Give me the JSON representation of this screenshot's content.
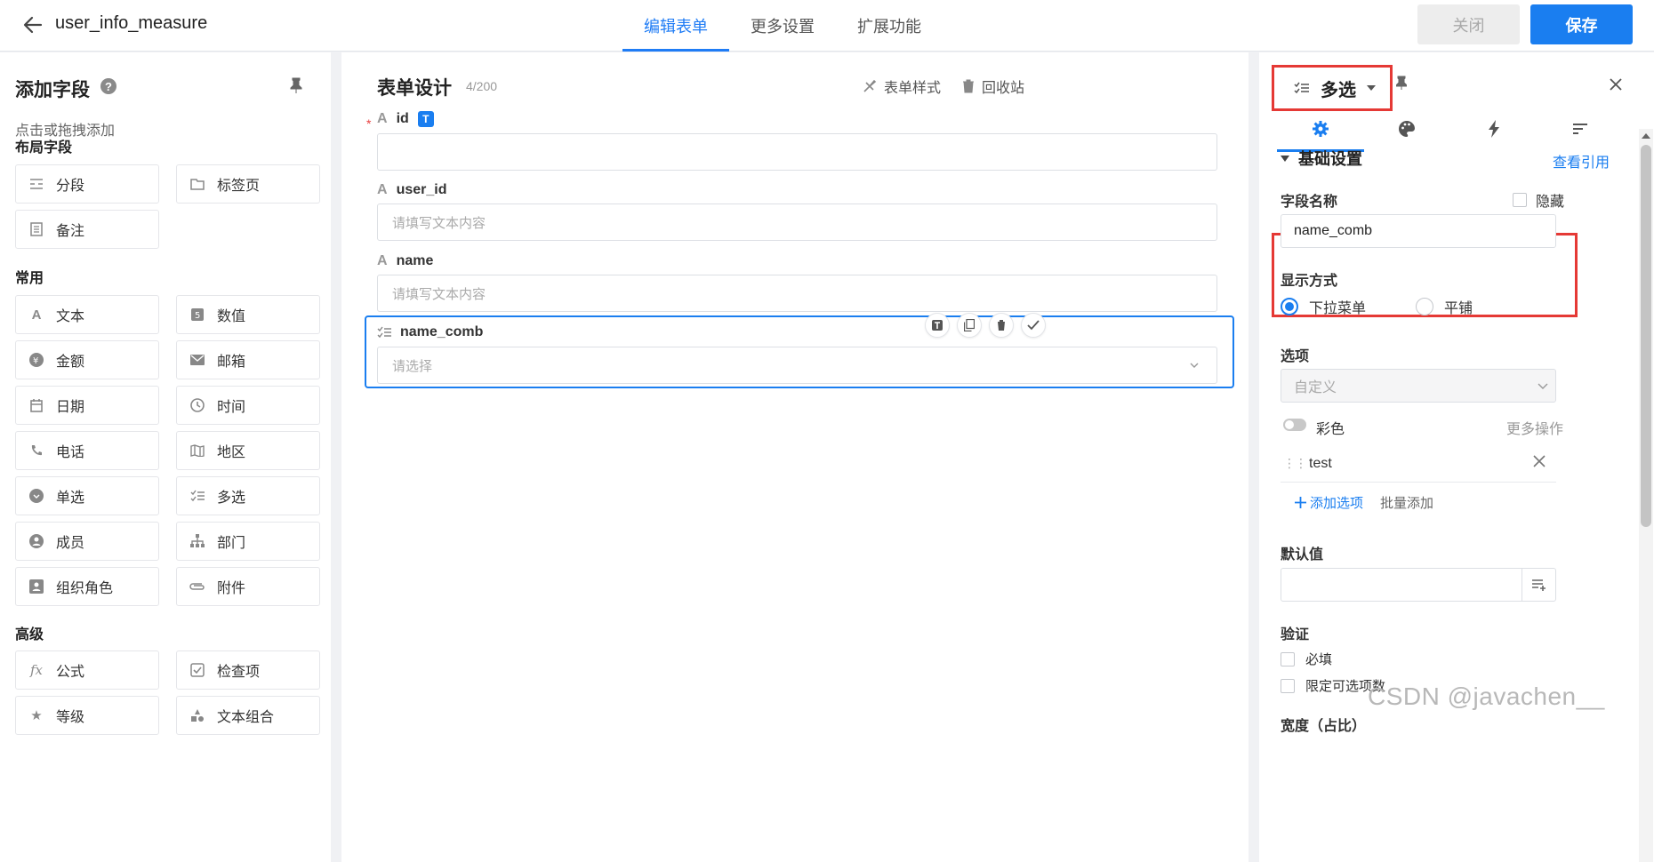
{
  "header": {
    "title": "user_info_measure",
    "tabs": [
      "编辑表单",
      "更多设置",
      "扩展功能"
    ],
    "close_label": "关闭",
    "save_label": "保存"
  },
  "left": {
    "title": "添加字段",
    "help": "?",
    "subtitle": "点击或拖拽添加",
    "groups": [
      {
        "title": "布局字段",
        "items": [
          {
            "label": "分段",
            "icon": "section-icon"
          },
          {
            "label": "标签页",
            "icon": "tab-page-icon"
          },
          {
            "label": "备注",
            "icon": "note-icon"
          }
        ]
      },
      {
        "title": "常用",
        "items": [
          {
            "label": "文本",
            "icon": "text-icon"
          },
          {
            "label": "数值",
            "icon": "number-icon"
          },
          {
            "label": "金额",
            "icon": "money-icon"
          },
          {
            "label": "邮箱",
            "icon": "email-icon"
          },
          {
            "label": "日期",
            "icon": "date-icon"
          },
          {
            "label": "时间",
            "icon": "time-icon"
          },
          {
            "label": "电话",
            "icon": "phone-icon"
          },
          {
            "label": "地区",
            "icon": "map-icon"
          },
          {
            "label": "单选",
            "icon": "single-select-icon"
          },
          {
            "label": "多选",
            "icon": "multi-select-icon"
          },
          {
            "label": "成员",
            "icon": "member-icon"
          },
          {
            "label": "部门",
            "icon": "department-icon"
          },
          {
            "label": "组织角色",
            "icon": "role-icon"
          },
          {
            "label": "附件",
            "icon": "attachment-icon"
          }
        ]
      },
      {
        "title": "高级",
        "items": [
          {
            "label": "公式",
            "icon": "formula-icon"
          },
          {
            "label": "检查项",
            "icon": "checkbox-icon"
          },
          {
            "label": "等级",
            "icon": "star-icon"
          },
          {
            "label": "文本组合",
            "icon": "text-combo-icon"
          }
        ]
      }
    ]
  },
  "canvas": {
    "title": "表单设计",
    "count": "4/200",
    "style_label": "表单样式",
    "recycle_label": "回收站",
    "fields": [
      {
        "label": "id",
        "required": true,
        "placeholder": ""
      },
      {
        "label": "user_id",
        "placeholder": "请填写文本内容"
      },
      {
        "label": "name",
        "placeholder": "请填写文本内容"
      },
      {
        "label": "name_comb",
        "placeholder": "请选择"
      }
    ],
    "id_badge": "T"
  },
  "right": {
    "type_title": "多选",
    "section_title": "基础设置",
    "see_ref": "查看引用",
    "field_name_label": "字段名称",
    "hidden_label": "隐藏",
    "field_name_value": "name_comb",
    "display_label": "显示方式",
    "display_options": [
      "下拉菜单",
      "平铺"
    ],
    "options_label": "选项",
    "options_select": "自定义",
    "color_label": "彩色",
    "more_ops": "更多操作",
    "option_item": "test",
    "add_option": "添加选项",
    "bulk_add": "批量添加",
    "default_label": "默认值",
    "validation_label": "验证",
    "required_label": "必填",
    "limit_label": "限定可选项数",
    "width_label": "宽度（占比）"
  },
  "watermark": "CSDN @javachen__",
  "colors": {
    "accent": "#1a7ef0",
    "highlight": "#e53935"
  }
}
